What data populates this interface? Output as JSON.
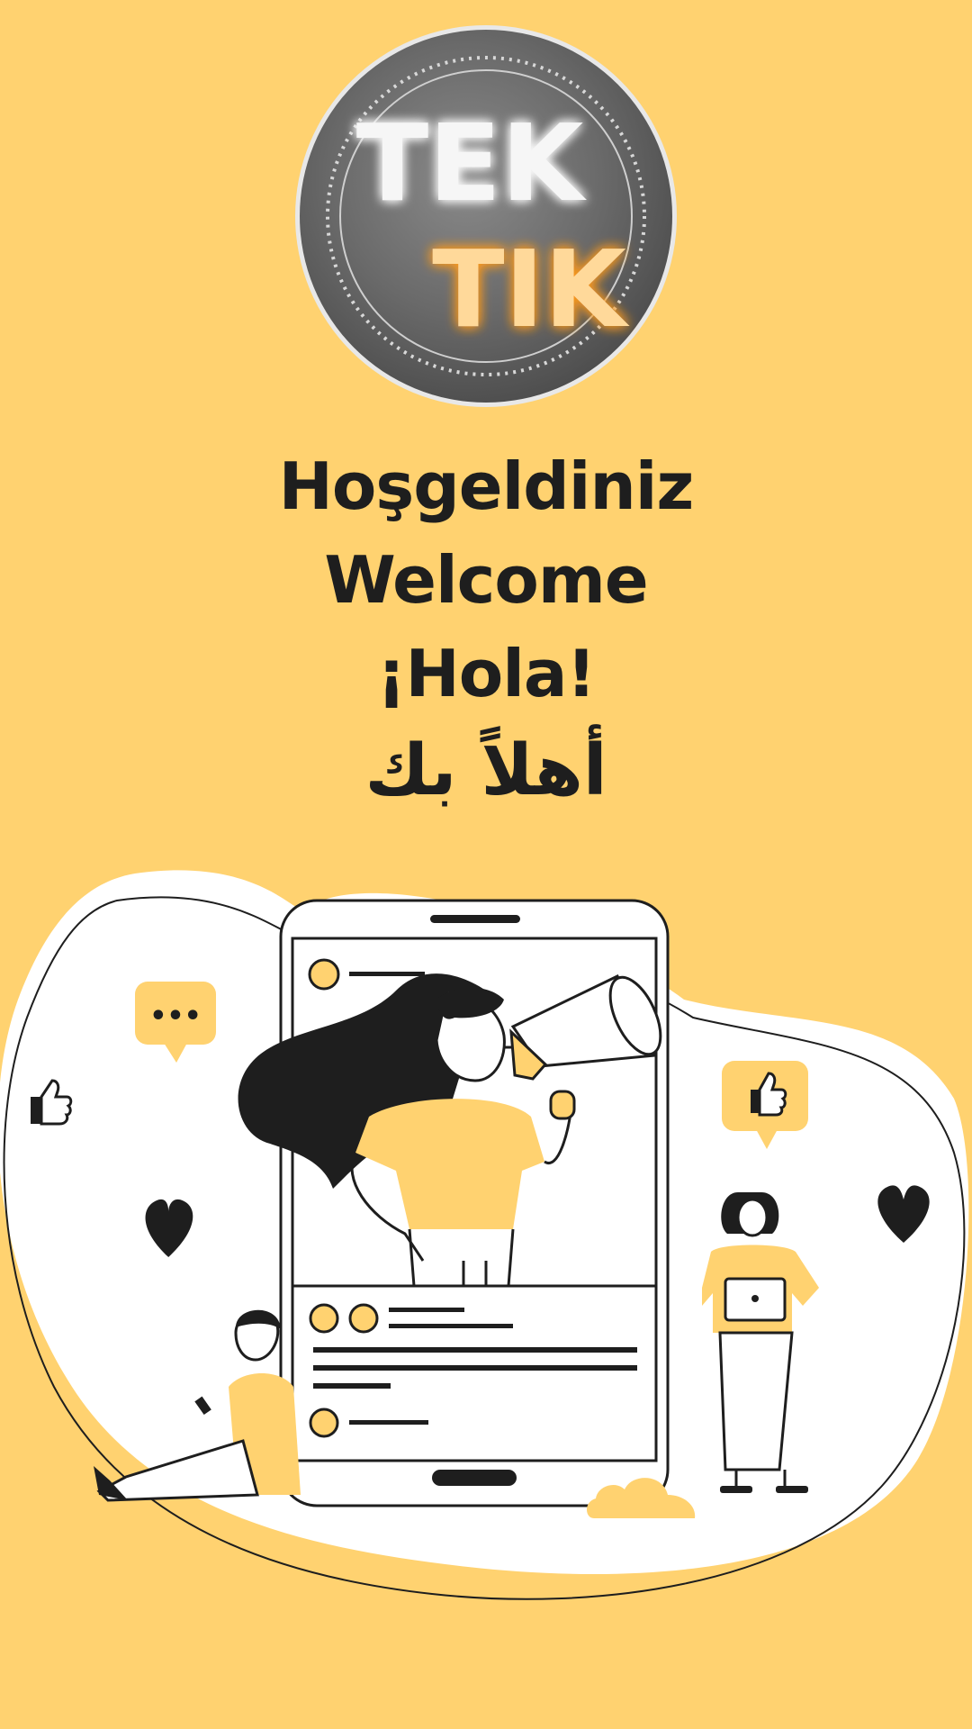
{
  "app": {
    "name": "TEK TIK"
  },
  "logo": {
    "line1": "TEK",
    "line2": "TIK",
    "line1_color": "#F6F6F6",
    "line2_color": "#FFD99A",
    "badge_color": "#5E5E5E"
  },
  "greetings": [
    {
      "text": "Hoşgeldiniz",
      "lang": "tr"
    },
    {
      "text": "Welcome",
      "lang": "en"
    },
    {
      "text": "¡Hola!",
      "lang": "es"
    },
    {
      "text": "أهلاً بك",
      "lang": "ar"
    }
  ],
  "illustration": {
    "chat_bubble_text": "•••",
    "icons": [
      "like-icon",
      "heart-icon",
      "chat-icon",
      "megaphone-icon",
      "cloud-icon"
    ]
  },
  "colors": {
    "background": "#FFD270",
    "accent": "#FFD270",
    "ink": "#1E1E1E",
    "white": "#FFFFFF"
  }
}
